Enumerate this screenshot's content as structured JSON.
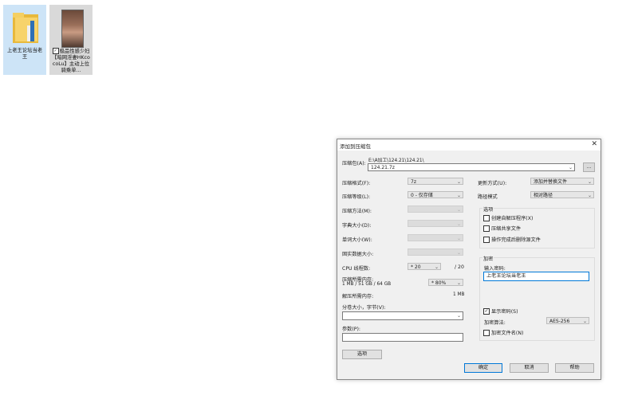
{
  "desktop": {
    "icons": [
      {
        "label": "上老王论坛当老王",
        "icon": "folder-icon"
      },
      {
        "label": "极品性感少妇【暗网淫妻HKcocoLu】主动上位骑乘单...",
        "icon": "video-thumbnail"
      }
    ]
  },
  "dialog": {
    "title": "添加到压缩包",
    "archive_label": "压缩包(A):",
    "archive_path": "E:\\A加工\\124.21\\124.21\\",
    "archive_name": "124.21.7z",
    "browse_label": "...",
    "format_label": "压缩格式(F):",
    "format_value": "7z",
    "level_label": "压缩等级(L):",
    "level_value": "0 - 仅存储",
    "method_label": "压缩方法(M):",
    "dict_label": "字典大小(D):",
    "word_label": "单词大小(W):",
    "solid_label": "固实数据大小:",
    "cpu_label": "CPU 线程数:",
    "cpu_value": "20",
    "cpu_max": "/ 20",
    "mem_label": "压缩所需内存:",
    "mem_detail": "1 MB / 51 GB / 64 GB",
    "mem_percent": "80%",
    "decomp_label": "解压所需内存:",
    "decomp_value": "1 MB",
    "split_label": "分卷大小，字节(V):",
    "params_label": "参数(P):",
    "options_button": "选项",
    "update_label": "更新方式(U):",
    "update_value": "添加并替换文件",
    "path_label": "路径模式",
    "path_value": "相对路径",
    "options_group": "选项",
    "opt_sfx": "创建自解压程序(X)",
    "opt_shared": "压缩共享文件",
    "opt_delete": "操作完成后删除源文件",
    "enc_group": "加密",
    "enc_password_label": "输入密码:",
    "enc_password": "上老王论坛当老王",
    "show_password": "显示密码(S)",
    "enc_method_label": "加密算法:",
    "enc_method": "AES-256",
    "enc_names": "加密文件名(N)",
    "ok": "确定",
    "cancel": "取消",
    "help": "帮助",
    "close_icon": "close-icon"
  }
}
